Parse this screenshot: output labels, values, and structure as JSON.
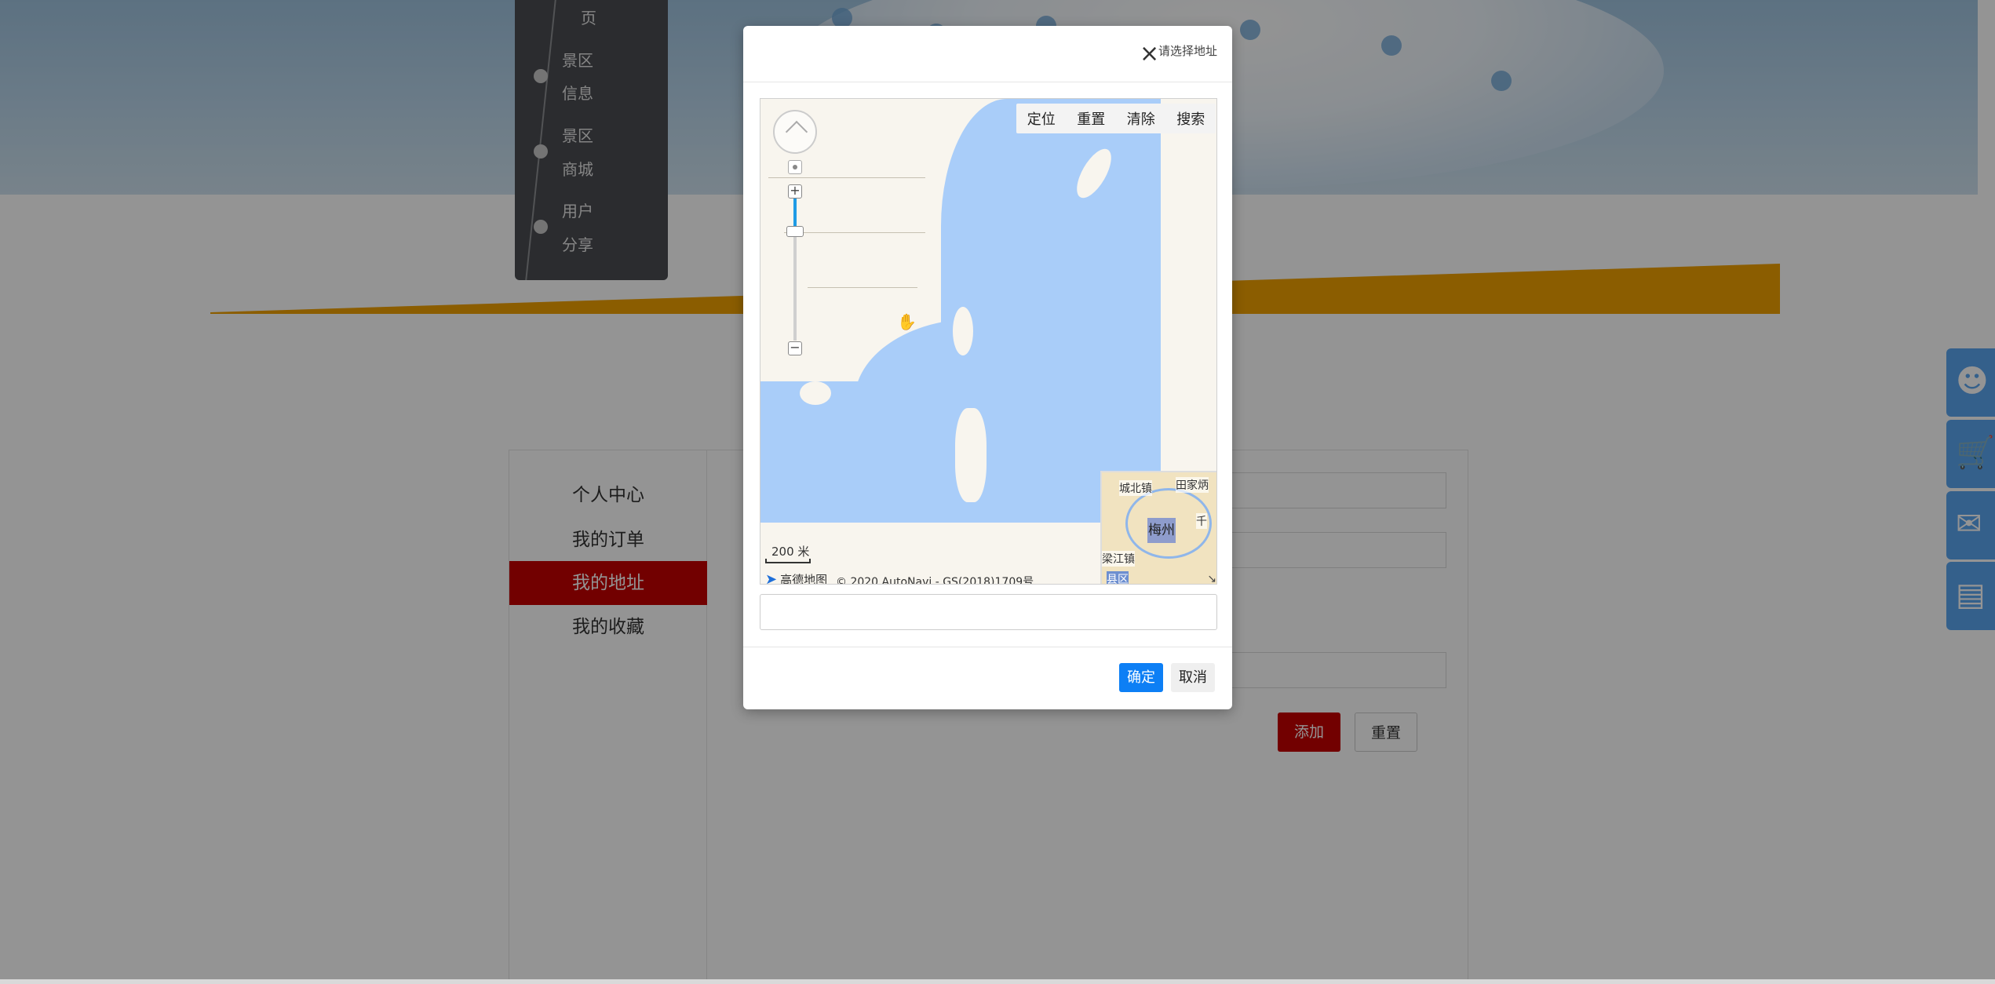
{
  "timeline": {
    "items": [
      "页",
      "景区",
      "信息",
      "景区",
      "商城",
      "用户",
      "分享"
    ]
  },
  "user_menu": {
    "items": [
      {
        "label": "个人中心",
        "active": false
      },
      {
        "label": "我的订单",
        "active": false
      },
      {
        "label": "我的地址",
        "active": true
      },
      {
        "label": "我的收藏",
        "active": false
      }
    ]
  },
  "form": {
    "add_label": "添加",
    "reset_label": "重置"
  },
  "float_bar": {
    "icons": [
      "user-icon",
      "cart-icon",
      "chat-icon",
      "monitor-icon"
    ]
  },
  "modal": {
    "close_glyph": "×",
    "title": "请选择地址",
    "map": {
      "tools": [
        "定位",
        "重置",
        "清除",
        "搜索"
      ],
      "scale": "200 米",
      "logo_text": "高德地图",
      "copyright": "© 2020 AutoNavi - GS(2018)1709号",
      "minimap": {
        "labels": [
          "城北镇",
          "田家炳",
          "千",
          "梅州",
          "梁江镇",
          "县区"
        ]
      }
    },
    "address_value": "",
    "ok_label": "确定",
    "cancel_label": "取消"
  },
  "colors": {
    "accent_red": "#c40000",
    "primary_blue": "#0d7ff5",
    "sea": "#a9cdf9",
    "stripe_orange": "#f0a000",
    "float_blue": "#5ba5f0"
  }
}
